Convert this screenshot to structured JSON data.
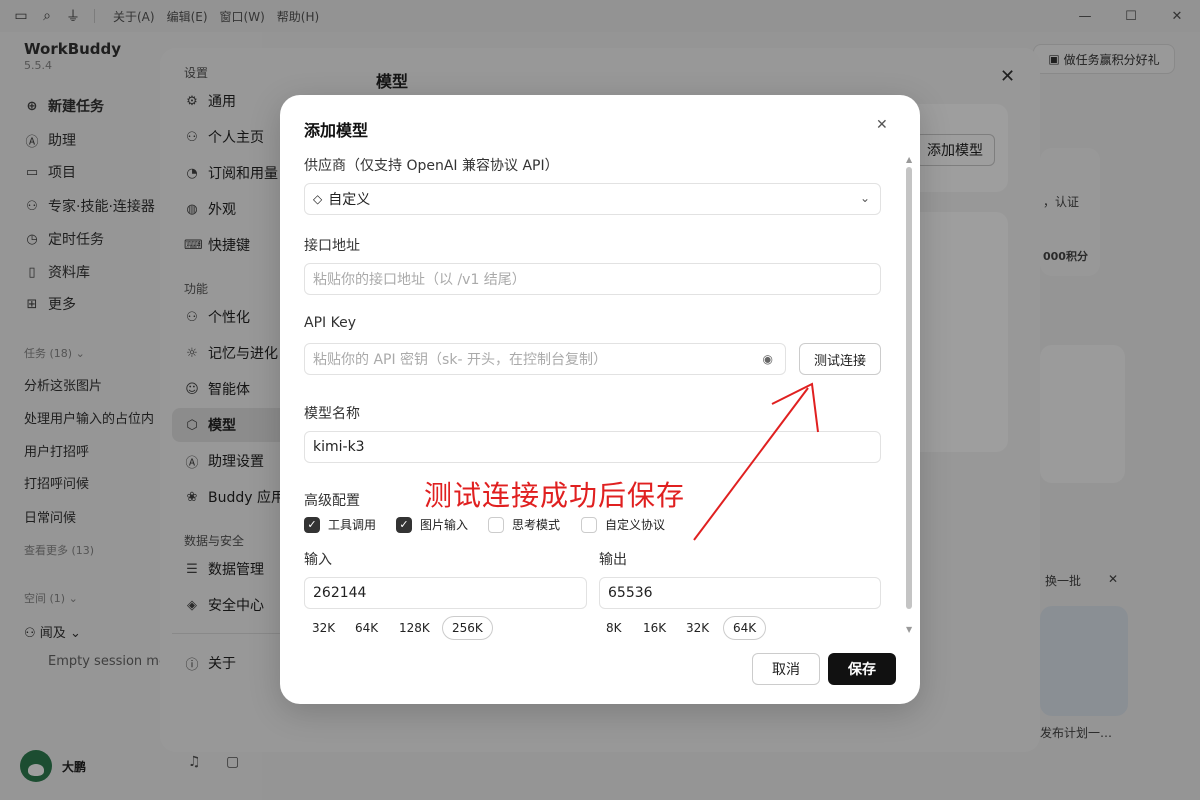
{
  "titlebar": {
    "menus": [
      "关于(A)",
      "编辑(E)",
      "窗口(W)",
      "帮助(H)"
    ],
    "icons": [
      "sidebar-icon",
      "search-icon",
      "filter-icon"
    ]
  },
  "app": {
    "name": "WorkBuddy",
    "version": "5.5.4"
  },
  "sidebar": {
    "nav": [
      {
        "label": "新建任务",
        "icon": "plus-circle-icon"
      },
      {
        "label": "助理",
        "icon": "assistant-icon"
      },
      {
        "label": "项目",
        "icon": "folder-icon"
      },
      {
        "label": "专家·技能·连接器",
        "icon": "expert-icon"
      },
      {
        "label": "定时任务",
        "icon": "clock-icon"
      },
      {
        "label": "资料库",
        "icon": "book-icon"
      },
      {
        "label": "更多",
        "icon": "grid-icon"
      }
    ],
    "tasks_header": "任务 (18)",
    "tasks": [
      "分析这张图片",
      "处理用户输入的占位内",
      "用户打招呼",
      "打招呼问候",
      "日常问候"
    ],
    "see_more": "查看更多 (13)",
    "space_header": "空间 (1)",
    "space_name": "闻及",
    "space_session": "Empty session me",
    "user": "大鹏"
  },
  "background": {
    "reward_button": "做任务赢积分好礼",
    "promo_text": "，认证",
    "promo_points": "000积分",
    "refresh": "换一批",
    "card_caption": "发布计划一…"
  },
  "settings": {
    "header_settings": "设置",
    "items_general": [
      {
        "label": "通用",
        "icon": "settings-icon"
      },
      {
        "label": "个人主页",
        "icon": "user-icon"
      },
      {
        "label": "订阅和用量",
        "icon": "pie-icon"
      },
      {
        "label": "外观",
        "icon": "palette-icon"
      },
      {
        "label": "快捷键",
        "icon": "keyboard-icon"
      }
    ],
    "header_features": "功能",
    "items_features": [
      {
        "label": "个性化",
        "icon": "personalize-icon"
      },
      {
        "label": "记忆与进化",
        "icon": "bulb-icon"
      },
      {
        "label": "智能体",
        "icon": "agent-icon"
      },
      {
        "label": "模型",
        "icon": "model-icon"
      },
      {
        "label": "助理设置",
        "icon": "assistant-icon"
      },
      {
        "label": "Buddy 应用",
        "icon": "buddy-icon"
      }
    ],
    "header_security": "数据与安全",
    "items_security": [
      {
        "label": "数据管理",
        "icon": "database-icon"
      },
      {
        "label": "安全中心",
        "icon": "shield-icon"
      }
    ],
    "about": "关于",
    "panel_title": "模型",
    "add_model_button": "添加模型"
  },
  "dialog": {
    "title": "添加模型",
    "provider_label": "供应商（仅支持 OpenAI 兼容协议 API）",
    "provider_value": "自定义",
    "endpoint_label": "接口地址",
    "endpoint_placeholder": "粘贴你的接口地址（以 /v1 结尾）",
    "apikey_label": "API Key",
    "apikey_placeholder": "粘贴你的 API 密钥（sk- 开头，在控制台复制）",
    "test_button": "测试连接",
    "model_name_label": "模型名称",
    "model_name_value": "kimi-k3",
    "advanced_label": "高级配置",
    "options": [
      {
        "label": "工具调用",
        "checked": true
      },
      {
        "label": "图片输入",
        "checked": true
      },
      {
        "label": "思考模式",
        "checked": false
      },
      {
        "label": "自定义协议",
        "checked": false
      }
    ],
    "input_label": "输入",
    "input_value": "262144",
    "input_presets": [
      {
        "label": "32K",
        "selected": false
      },
      {
        "label": "64K",
        "selected": false
      },
      {
        "label": "128K",
        "selected": false
      },
      {
        "label": "256K",
        "selected": true
      }
    ],
    "output_label": "输出",
    "output_value": "65536",
    "output_presets": [
      {
        "label": "8K",
        "selected": false
      },
      {
        "label": "16K",
        "selected": false
      },
      {
        "label": "32K",
        "selected": false
      },
      {
        "label": "64K",
        "selected": true
      }
    ],
    "cancel_button": "取消",
    "save_button": "保存"
  },
  "annotation": {
    "text": "测试连接成功后保存",
    "color": "#e02020"
  }
}
